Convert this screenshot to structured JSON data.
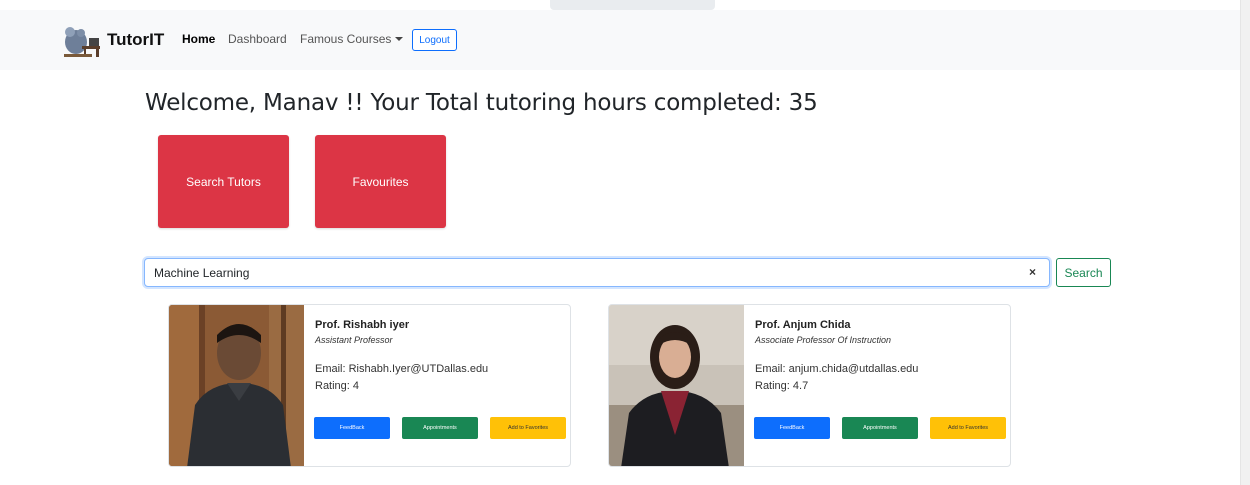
{
  "navbar": {
    "brand": "TutorIT",
    "links": [
      {
        "label": "Home"
      },
      {
        "label": "Dashboard"
      },
      {
        "label": "Famous Courses"
      }
    ],
    "logout_label": "Logout"
  },
  "welcome": {
    "text": "Welcome, Manav !! Your Total tutoring hours completed: 35"
  },
  "tiles": {
    "search_label": "Search Tutors",
    "favourites_label": "Favourites"
  },
  "search": {
    "value": "Machine Learning",
    "clear_icon": "×",
    "button_label": "Search"
  },
  "tutors": [
    {
      "name": "Prof. Rishabh iyer",
      "title": "Assistant Professor",
      "email": "Email: Rishabh.Iyer@UTDallas.edu",
      "rating": "Rating: 4",
      "feedback_label": "FeedBack",
      "appointments_label": "Appointments",
      "favorites_label": "Add to Favorites"
    },
    {
      "name": "Prof. Anjum Chida",
      "title": "Associate Professor Of Instruction",
      "email": "Email: anjum.chida@utdallas.edu",
      "rating": "Rating: 4.7",
      "feedback_label": "FeedBack",
      "appointments_label": "Appointments",
      "favorites_label": "Add to Favorites"
    }
  ],
  "colors": {
    "tile_red": "#dc3545",
    "feedback_blue": "#0d6efd",
    "appointments_green": "#198754",
    "favorites_yellow": "#ffc107"
  }
}
